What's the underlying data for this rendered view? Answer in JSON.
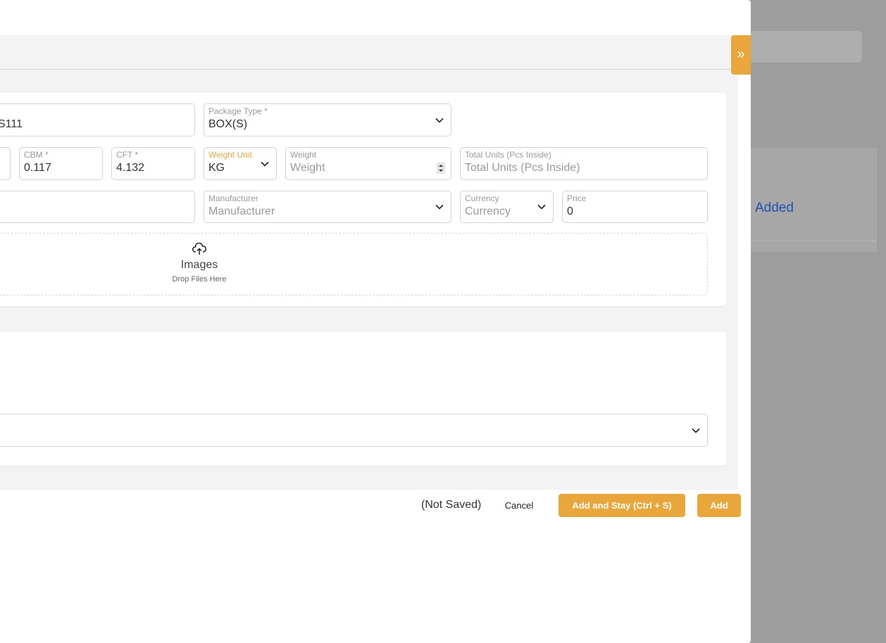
{
  "background": {
    "card_text": "Added"
  },
  "modal": {
    "collapse_icon": "»",
    "fields": {
      "code": {
        "value": "S111"
      },
      "package_type": {
        "label": "Package Type *",
        "value": "BOX(S)"
      },
      "cbm": {
        "label": "CBM *",
        "value": "0.117"
      },
      "cft": {
        "label": "CFT *",
        "value": "4.132"
      },
      "weight_unit": {
        "label": "Weight Unit",
        "value": "KG"
      },
      "weight": {
        "label": "Weight",
        "placeholder": "Weight"
      },
      "total_units": {
        "label": "Total Units (Pcs Inside)",
        "placeholder": "Total Units (Pcs Inside)"
      },
      "manufacturer": {
        "label": "Manufacturer",
        "placeholder": "Manufacturer"
      },
      "currency": {
        "label": "Currency",
        "placeholder": "Currency"
      },
      "price": {
        "label": "Price",
        "value": "0"
      }
    },
    "dropzone": {
      "icon": "cloud-upload-icon",
      "title": "Images",
      "subtitle": "Drop Files Here"
    }
  },
  "footer": {
    "status": "(Not Saved)",
    "cancel_label": "Cancel",
    "add_stay_label": "Add and Stay (Ctrl + S)",
    "add_label": "Add"
  },
  "colors": {
    "accent": "#e9a73b",
    "link_blue": "#1f53b0"
  }
}
